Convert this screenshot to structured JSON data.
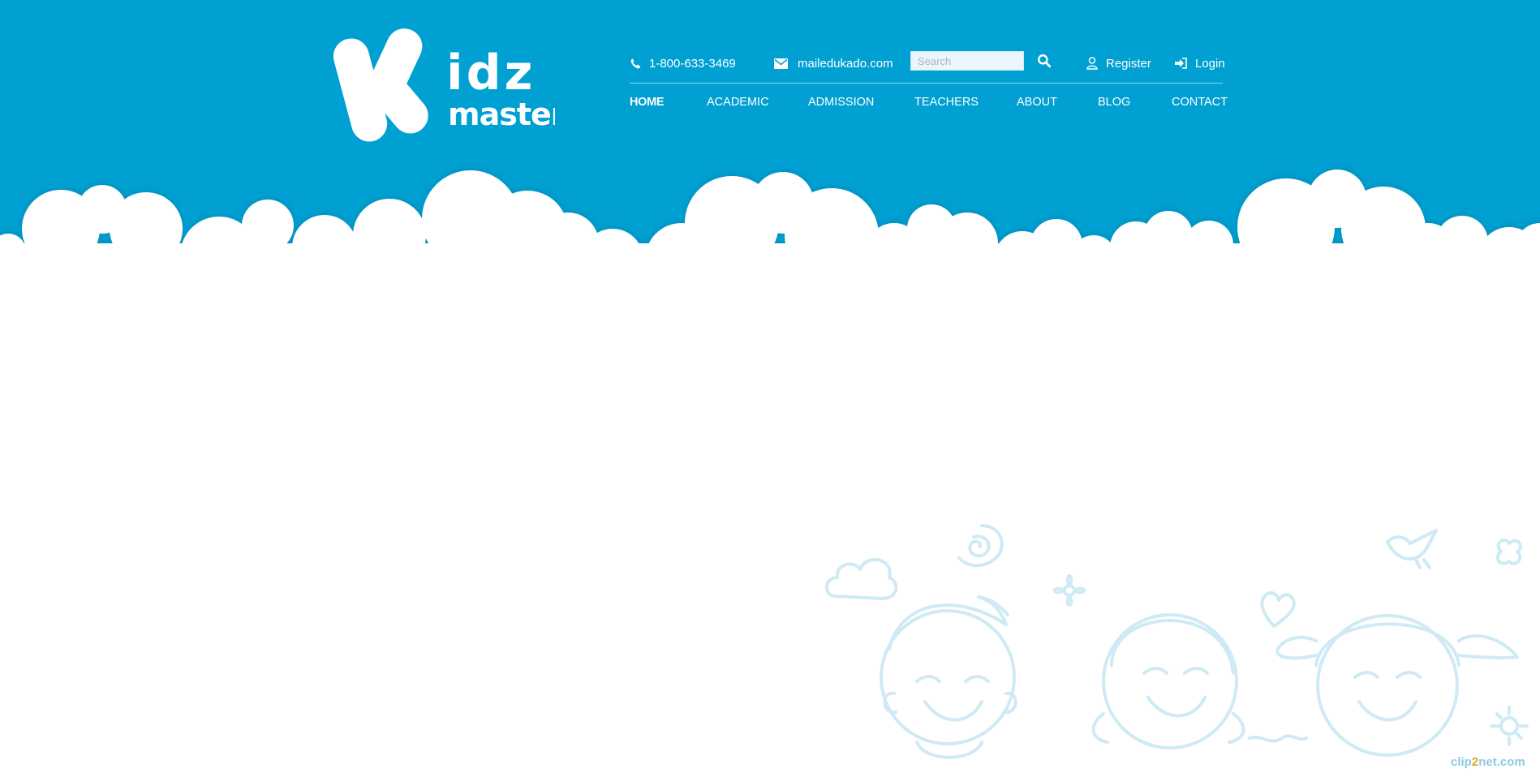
{
  "brand": {
    "logo_lettering": "idz master"
  },
  "topbar": {
    "phone": "1-800-633-3469",
    "email": "mailedukado.com",
    "search_placeholder": "Search",
    "register_label": "Register",
    "login_label": "Login"
  },
  "nav": {
    "items": [
      {
        "label": "HOME",
        "active": true
      },
      {
        "label": "ACADEMIC",
        "active": false
      },
      {
        "label": "ADMISSION",
        "active": false
      },
      {
        "label": "TEACHERS",
        "active": false
      },
      {
        "label": "ABOUT",
        "active": false
      },
      {
        "label": "BLOG",
        "active": false
      },
      {
        "label": "CONTACT",
        "active": false
      }
    ]
  },
  "watermark": {
    "prefix": "clip",
    "digit": "2",
    "suffix": "net.com"
  },
  "colors": {
    "header_blue": "#00a0d2",
    "text": "#ffffff",
    "illustration": "#cfeaf4"
  },
  "icons": [
    "phone-icon",
    "envelope-icon",
    "search-icon",
    "user-icon",
    "sign-in-icon"
  ]
}
